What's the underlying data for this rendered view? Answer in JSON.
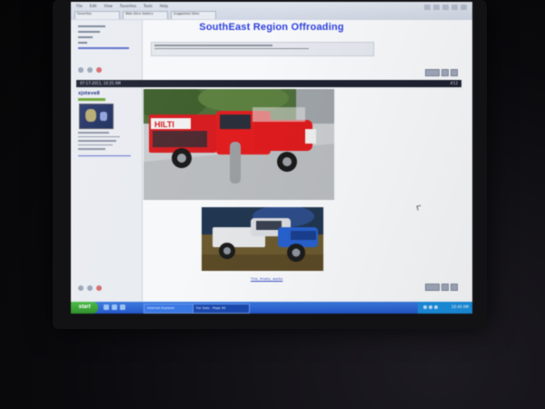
{
  "browser": {
    "menu": [
      "File",
      "Edit",
      "View",
      "Favorites",
      "Tools",
      "Help"
    ],
    "tabs": [
      "Favorites",
      "Web Slice Gallery",
      "Suggested Sites"
    ]
  },
  "forum": {
    "signature_title": "SouthEast Region Offroading",
    "post": {
      "date": "07-17-2011, 10:25 AM",
      "number": "#12",
      "username": "xjsteve8",
      "link_text": "This, finally, works"
    }
  },
  "taskbar": {
    "start_label": "start",
    "tasks": [
      "Internet Explorer",
      "For Sale - Page 40"
    ],
    "clock": "10:44 AM"
  },
  "colors": {
    "title_blue": "#2d3fd6",
    "truck_red": "#d41e1e",
    "taskbar_blue": "#2456c4"
  }
}
